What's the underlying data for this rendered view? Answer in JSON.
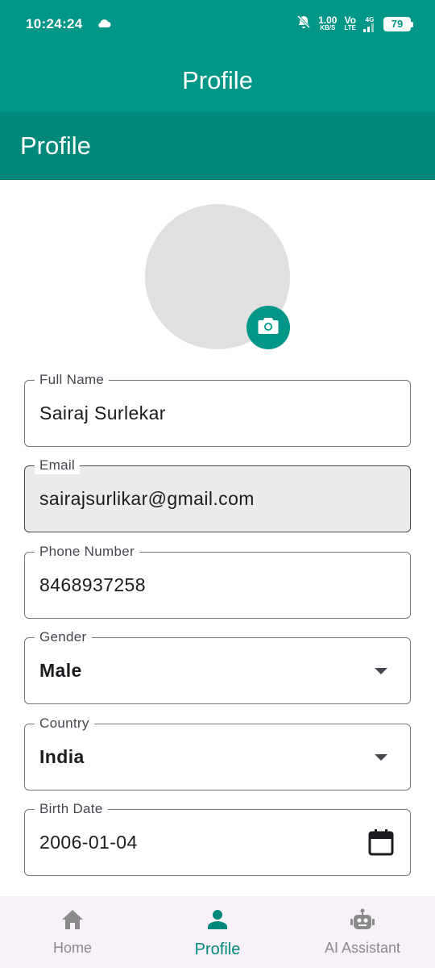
{
  "status_bar": {
    "time": "10:24:24",
    "net_speed_value": "1.00",
    "net_speed_unit": "KB/S",
    "volte_top": "Vo",
    "volte_bottom": "LTE",
    "network": "4G",
    "battery": "79"
  },
  "app_bar": {
    "title": "Profile"
  },
  "section_header": {
    "title": "Profile"
  },
  "form": {
    "full_name": {
      "label": "Full Name",
      "value": "Sairaj Surlekar"
    },
    "email": {
      "label": "Email",
      "value": "sairajsurlikar@gmail.com"
    },
    "phone": {
      "label": "Phone Number",
      "value": "8468937258"
    },
    "gender": {
      "label": "Gender",
      "value": "Male"
    },
    "country": {
      "label": "Country",
      "value": "India"
    },
    "birth_date": {
      "label": "Birth Date",
      "value": "2006-01-04"
    }
  },
  "bottom_nav": {
    "items": [
      {
        "label": "Home",
        "icon": "home-icon",
        "active": false
      },
      {
        "label": "Profile",
        "icon": "person-icon",
        "active": true
      },
      {
        "label": "AI Assistant",
        "icon": "robot-icon",
        "active": false
      }
    ]
  },
  "colors": {
    "primary": "#009688",
    "primary_dark": "#00897b",
    "nav_background": "#f8f1fa",
    "email_field_background": "#ebebeb"
  }
}
